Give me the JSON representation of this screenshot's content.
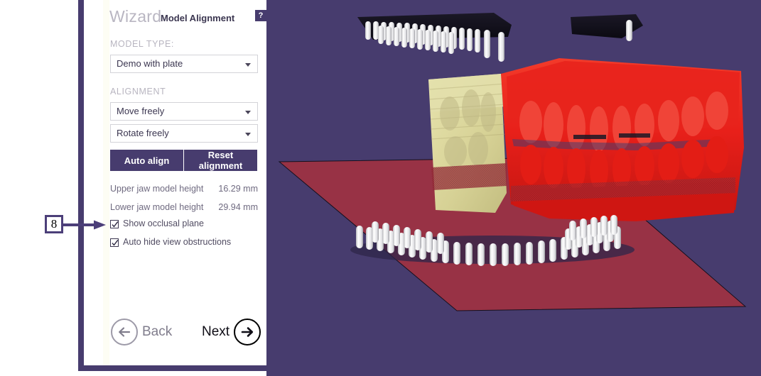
{
  "app": {
    "viewport_bg": "#473c6e",
    "panel_border_color": "#473c6e",
    "accent": "#473c6e"
  },
  "wizard": {
    "title": "Wizard",
    "subtitle": "Model Alignment",
    "help_label": "?",
    "model_type": {
      "label": "MODEL TYPE:",
      "value": "Demo with plate"
    },
    "alignment": {
      "label": "ALIGNMENT",
      "move_value": "Move freely",
      "rotate_value": "Rotate freely",
      "auto_align_label": "Auto align",
      "reset_alignment_label": "Reset alignment"
    },
    "metrics": [
      {
        "name": "Upper jaw model height",
        "value": "16.29 mm"
      },
      {
        "name": "Lower jaw model height",
        "value": "29.94 mm"
      }
    ],
    "checkboxes": [
      {
        "label": "Show occlusal plane",
        "checked": true
      },
      {
        "label": "Auto hide view obstructions",
        "checked": false
      }
    ],
    "nav": {
      "back_label": "Back",
      "next_label": "Next",
      "back_icon": "arrow-left-icon",
      "next_icon": "arrow-right-icon"
    }
  },
  "annotation": {
    "number": "8",
    "points_to": "Show occlusal plane",
    "color": "#4c3f79"
  },
  "viewport_3d": {
    "description": "Dental 3D model alignment view",
    "model_color": "#e8201a",
    "secondary_model_color": "#ddd9a0",
    "plane_color": "#b0303a",
    "pin_color": "#f2f2f2",
    "plate_color": "#131118"
  }
}
